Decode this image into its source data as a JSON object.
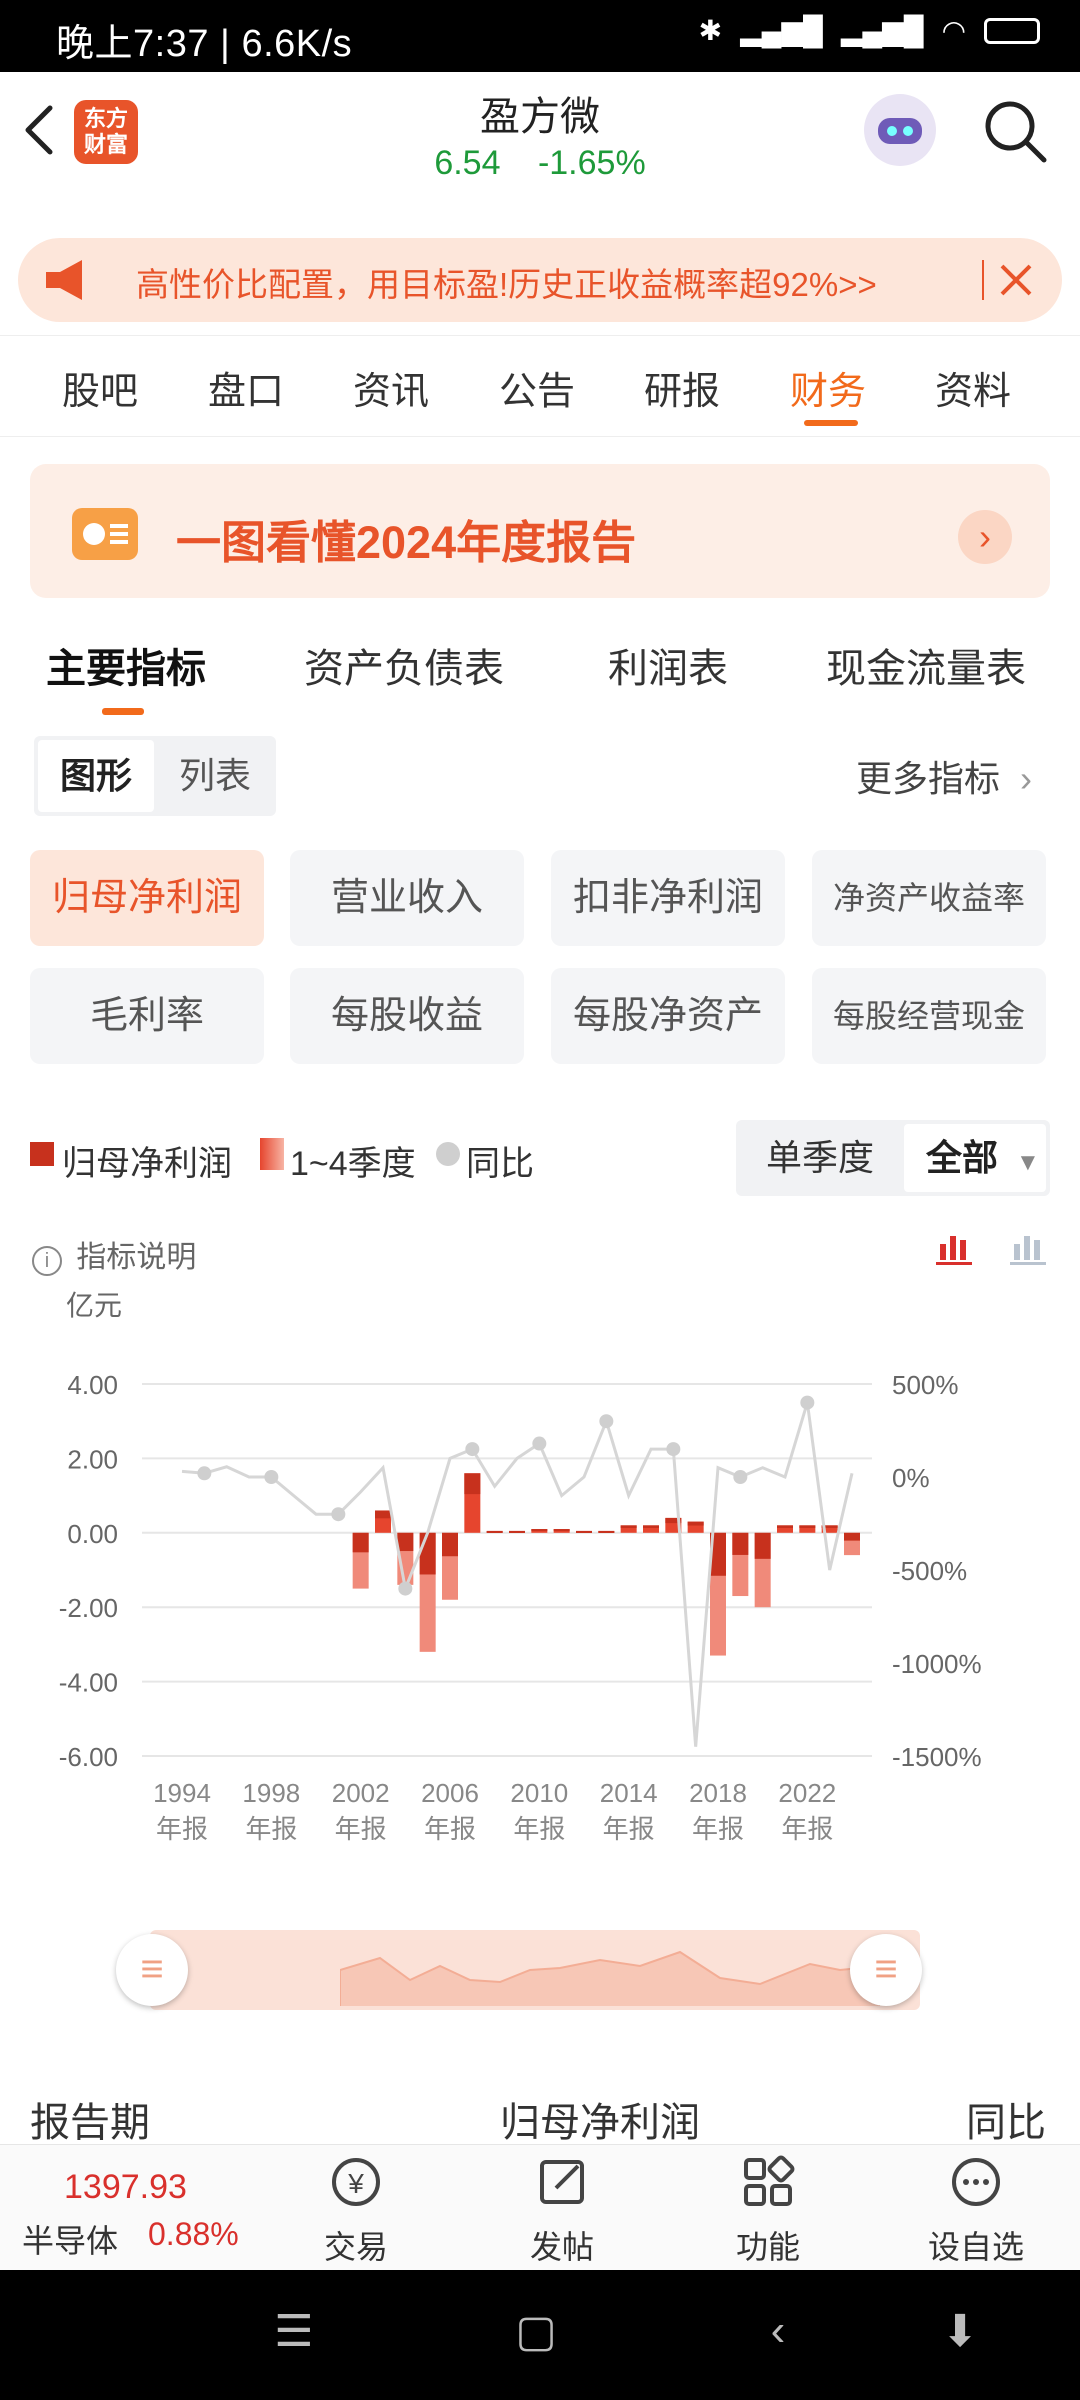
{
  "status_bar": {
    "time": "晚上7:37 | 6.6K/s",
    "right_icons": [
      "bluetooth-icon",
      "signal-hd-icon",
      "signal-hd-icon",
      "wifi-icon",
      "battery-icon"
    ]
  },
  "header": {
    "app_logo": "东方\n财富",
    "stock_name": "盈方微",
    "price": "6.54",
    "change": "-1.65%"
  },
  "banner": {
    "text": "高性价比配置，用目标盈!历史正收益概率超92%>>"
  },
  "tabs": [
    "股吧",
    "盘口",
    "资讯",
    "公告",
    "研报",
    "财务",
    "资料"
  ],
  "active_tab": "财务",
  "report_card": {
    "title": "一图看懂2024年度报告"
  },
  "sub_tabs": [
    "主要指标",
    "资产负债表",
    "利润表",
    "现金流量表"
  ],
  "view_toggle": {
    "on": "图形",
    "off": "列表"
  },
  "more_metrics": "更多指标",
  "metrics": [
    "归母净利润",
    "营业收入",
    "扣非净利润",
    "净资产收益率",
    "毛利率",
    "每股收益",
    "每股净资产",
    "每股经营现金"
  ],
  "legend": {
    "item1": "归母净利润",
    "item2": "1~4季度",
    "item3": "同比"
  },
  "period_toggle": {
    "off": "单季度",
    "on": "全部"
  },
  "explain": "指标说明",
  "chart_data": {
    "type": "bar",
    "ylabel": "亿元",
    "ylim": [
      -6,
      4
    ],
    "yticks": [
      "4.00",
      "2.00",
      "0.00",
      "-2.00",
      "-4.00",
      "-6.00"
    ],
    "y2lim": [
      -1500,
      500
    ],
    "y2ticks": [
      "500%",
      "0%",
      "-500%",
      "-1000%",
      "-1500%"
    ],
    "xticks": [
      {
        "year": "1994",
        "sub": "年报"
      },
      {
        "year": "1998",
        "sub": "年报"
      },
      {
        "year": "2002",
        "sub": "年报"
      },
      {
        "year": "2006",
        "sub": "年报"
      },
      {
        "year": "2010",
        "sub": "年报"
      },
      {
        "year": "2014",
        "sub": "年报"
      },
      {
        "year": "2018",
        "sub": "年报"
      },
      {
        "year": "2022",
        "sub": "年报"
      }
    ],
    "categories": [
      1994,
      1995,
      1996,
      1997,
      1998,
      1999,
      2000,
      2001,
      2002,
      2003,
      2004,
      2005,
      2006,
      2007,
      2008,
      2009,
      2010,
      2011,
      2012,
      2013,
      2014,
      2015,
      2016,
      2017,
      2018,
      2019,
      2020,
      2021,
      2022,
      2023,
      2024
    ],
    "annual_values": [
      0,
      0,
      0,
      0,
      0,
      0,
      0,
      0,
      -1.5,
      0.6,
      -1.4,
      -3.2,
      -1.8,
      1.6,
      0.05,
      0.05,
      0.1,
      0.1,
      0.05,
      0.05,
      0.2,
      0.2,
      0.4,
      0.3,
      -3.3,
      -1.7,
      -2.0,
      0.2,
      0.2,
      0.2,
      -0.6
    ],
    "yoy_pct": [
      30,
      20,
      55,
      0,
      0,
      -100,
      -200,
      -200,
      -80,
      50,
      -600,
      -300,
      100,
      150,
      -50,
      100,
      180,
      -100,
      0,
      300,
      -100,
      150,
      150,
      -1450,
      50,
      0,
      50,
      0,
      400,
      -500,
      20
    ]
  },
  "range_handle_icon": "drag-handle-icon",
  "table_header": {
    "col1": "报告期",
    "col2": "归母净利润",
    "col3": "同比"
  },
  "bottom_bar": {
    "index_value": "1397.93",
    "index_name": "半导体",
    "index_change": "0.88%",
    "items": [
      {
        "icon": "yen-exchange-icon",
        "label": "交易"
      },
      {
        "icon": "edit-icon",
        "label": "发帖"
      },
      {
        "icon": "apps-grid-icon",
        "label": "功能"
      },
      {
        "icon": "more-icon",
        "label": "设自选"
      }
    ]
  },
  "colors": {
    "accent": "#f26a1b",
    "price_down": "#1e9a3a",
    "index_up": "#d9302c",
    "bar_dark": "#c7311d",
    "bar_light": "#f08a7a"
  }
}
